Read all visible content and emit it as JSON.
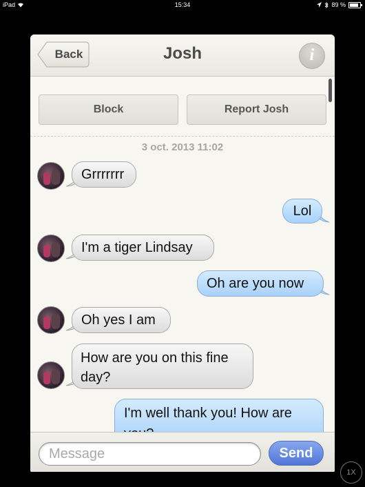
{
  "status_bar": {
    "device": "iPad",
    "time": "15:34",
    "battery": "89 %"
  },
  "nav": {
    "back_label": "Back",
    "title": "Josh",
    "info_icon": "i"
  },
  "actions": {
    "block_label": "Block",
    "report_label": "Report Josh"
  },
  "thread": {
    "timestamp": "3 oct. 2013 11:02",
    "messages": [
      {
        "from": "them",
        "text": "Grrrrrrr"
      },
      {
        "from": "me",
        "text": "Lol"
      },
      {
        "from": "them",
        "text": "I'm a tiger Lindsay"
      },
      {
        "from": "me",
        "text": "Oh are you now"
      },
      {
        "from": "them",
        "text": "Oh yes I am"
      },
      {
        "from": "them",
        "text": "How are you on this fine day?"
      },
      {
        "from": "me",
        "text": "I'm well thank you! How are you?"
      }
    ]
  },
  "composer": {
    "placeholder": "Message",
    "send_label": "Send"
  },
  "zoom_indicator": "1X",
  "colors": {
    "outgoing_bubble": "#a8d1fb",
    "incoming_bubble": "#dcdcdc",
    "send_button": "#2d5bd8"
  }
}
